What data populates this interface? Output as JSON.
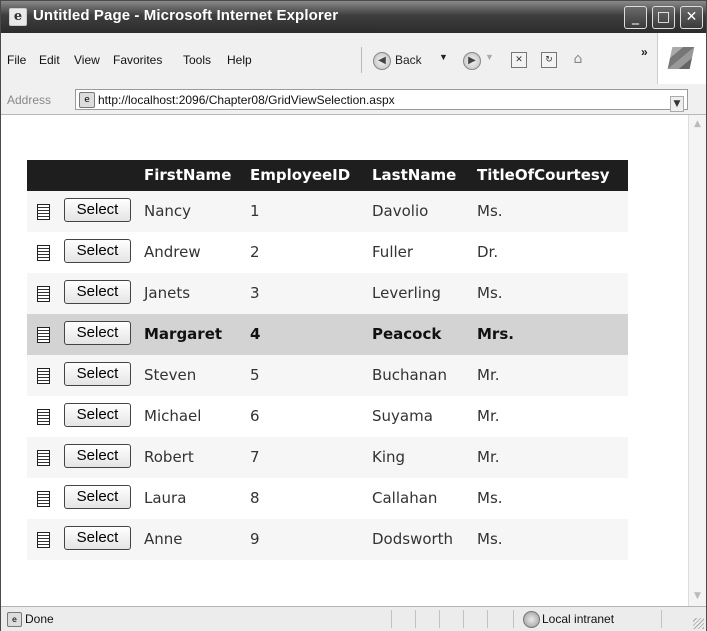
{
  "window": {
    "title": "Untitled Page - Microsoft Internet Explorer",
    "controls": {
      "minimize": "_",
      "maximize": "□",
      "close": "✕"
    }
  },
  "menubar": {
    "items": [
      "File",
      "Edit",
      "View",
      "Favorites",
      "Tools",
      "Help"
    ],
    "back_label": "Back",
    "overflow": "»"
  },
  "addressbar": {
    "label": "Address",
    "url": "http://localhost:2096/Chapter08/GridViewSelection.aspx"
  },
  "grid": {
    "headers": [
      "FirstName",
      "EmployeeID",
      "LastName",
      "TitleOfCourtesy"
    ],
    "select_label": "Select",
    "selected_index": 3,
    "rows": [
      {
        "first": "Nancy",
        "id": "1",
        "last": "Davolio",
        "title": "Ms."
      },
      {
        "first": "Andrew",
        "id": "2",
        "last": "Fuller",
        "title": "Dr."
      },
      {
        "first": "Janets",
        "id": "3",
        "last": "Leverling",
        "title": "Ms."
      },
      {
        "first": "Margaret",
        "id": "4",
        "last": "Peacock",
        "title": "Mrs."
      },
      {
        "first": "Steven",
        "id": "5",
        "last": "Buchanan",
        "title": "Mr."
      },
      {
        "first": "Michael",
        "id": "6",
        "last": "Suyama",
        "title": "Mr."
      },
      {
        "first": "Robert",
        "id": "7",
        "last": "King",
        "title": "Mr."
      },
      {
        "first": "Laura",
        "id": "8",
        "last": "Callahan",
        "title": "Ms."
      },
      {
        "first": "Anne",
        "id": "9",
        "last": "Dodsworth",
        "title": "Ms."
      }
    ]
  },
  "statusbar": {
    "status": "Done",
    "zone": "Local intranet"
  }
}
